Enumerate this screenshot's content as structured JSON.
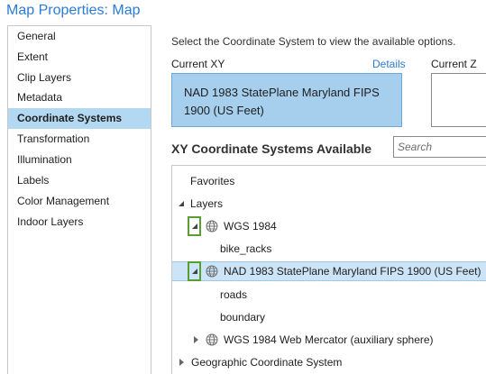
{
  "window": {
    "title": "Map Properties: Map"
  },
  "sidebar": {
    "items": [
      {
        "label": "General",
        "selected": false
      },
      {
        "label": "Extent",
        "selected": false
      },
      {
        "label": "Clip Layers",
        "selected": false
      },
      {
        "label": "Metadata",
        "selected": false
      },
      {
        "label": "Coordinate Systems",
        "selected": true
      },
      {
        "label": "Transformation",
        "selected": false
      },
      {
        "label": "Illumination",
        "selected": false
      },
      {
        "label": "Labels",
        "selected": false
      },
      {
        "label": "Color Management",
        "selected": false
      },
      {
        "label": "Indoor Layers",
        "selected": false
      }
    ]
  },
  "main": {
    "instruction": "Select the Coordinate System to view the available options.",
    "current_xy_label": "Current XY",
    "details_link": "Details",
    "current_z_label": "Current Z",
    "current_xy_value": "NAD 1983 StatePlane Maryland FIPS 1900 (US Feet)",
    "available_title": "XY Coordinate Systems Available",
    "search_placeholder": "Search"
  },
  "tree": {
    "favorites": "Favorites",
    "layers": "Layers",
    "wgs1984": "WGS 1984",
    "bike_racks": "bike_racks",
    "nad1983": "NAD 1983 StatePlane Maryland FIPS 1900 (US Feet)",
    "roads": "roads",
    "boundary": "boundary",
    "web_mercator": "WGS 1984 Web Mercator (auxiliary sphere)",
    "geographic": "Geographic Coordinate System"
  },
  "colors": {
    "accent": "#2b7cd3",
    "selection": "#b3d9f2",
    "current_xy_fill": "#a6cfee",
    "highlight_outline": "#5a9e2f"
  }
}
